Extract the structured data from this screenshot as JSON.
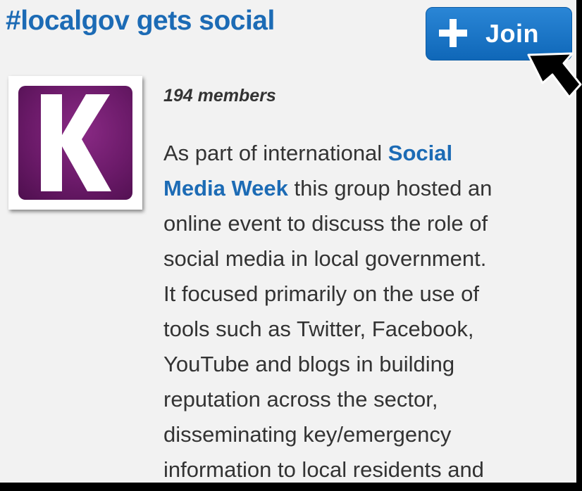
{
  "group": {
    "title": "#localgov gets social",
    "join_label": "Join",
    "members": "194 members",
    "logo_letter": "K"
  },
  "description": {
    "lines": [
      {
        "before": "As part of international ",
        "link": "Social",
        "after": ""
      },
      {
        "before": "",
        "link": "Media Week",
        "after": " this group hosted an"
      },
      {
        "before": "online event to discuss the role of",
        "link": "",
        "after": ""
      },
      {
        "before": "social media in local government.",
        "link": "",
        "after": ""
      },
      {
        "before": "It focused primarily on the use of",
        "link": "",
        "after": ""
      },
      {
        "before": "tools such as Twitter, Facebook,",
        "link": "",
        "after": ""
      },
      {
        "before": "YouTube and blogs in building",
        "link": "",
        "after": ""
      },
      {
        "before": "reputation across the sector,",
        "link": "",
        "after": ""
      },
      {
        "before": "disseminating key/emergency",
        "link": "",
        "after": ""
      },
      {
        "before": "information to local residents and",
        "link": "",
        "after": ""
      }
    ]
  },
  "colors": {
    "title": "#1c6bb5",
    "link": "#1c6bb5",
    "button": "#1a74c6",
    "logo": "#6b1a69",
    "background": "#f2f2f2"
  },
  "icons": {
    "join": "plus-icon",
    "cursor": "arrow-cursor-icon"
  }
}
